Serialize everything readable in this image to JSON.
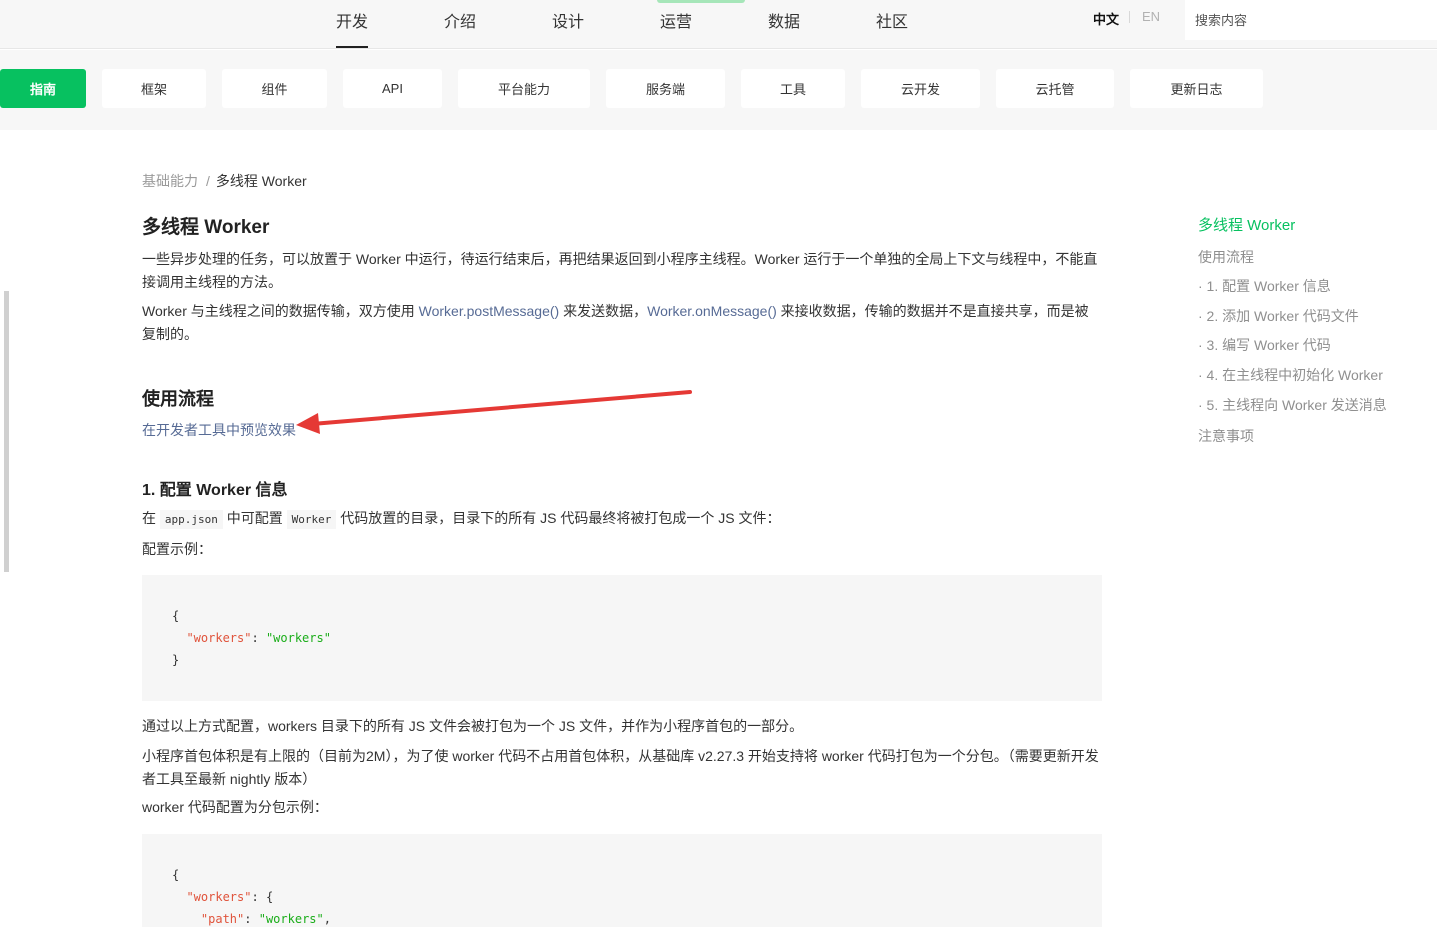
{
  "topnav": {
    "items": [
      {
        "label": "开发",
        "active": true
      },
      {
        "label": "介绍"
      },
      {
        "label": "设计"
      },
      {
        "label": "运营"
      },
      {
        "label": "数据"
      },
      {
        "label": "社区"
      }
    ],
    "lang_zh": "中文",
    "lang_en": "EN",
    "search_placeholder": "搜索内容"
  },
  "subnav": {
    "tabs": [
      {
        "label": "指南",
        "active": true
      },
      {
        "label": "框架"
      },
      {
        "label": "组件"
      },
      {
        "label": "API"
      },
      {
        "label": "平台能力"
      },
      {
        "label": "服务端"
      },
      {
        "label": "工具"
      },
      {
        "label": "云开发"
      },
      {
        "label": "云托管"
      },
      {
        "label": "更新日志"
      }
    ]
  },
  "breadcrumb": {
    "parent": "基础能力",
    "separator": "/",
    "current": "多线程 Worker"
  },
  "content": {
    "title": "多线程 Worker",
    "intro1": "一些异步处理的任务，可以放置于 Worker 中运行，待运行结束后，再把结果返回到小程序主线程。Worker 运行于一个单独的全局上下文与线程中，不能直接调用主线程的方法。",
    "intro2_a": "Worker 与主线程之间的数据传输，双方使用 ",
    "intro2_link1": "Worker.postMessage()",
    "intro2_b": " 来发送数据，",
    "intro2_link2": "Worker.onMessage()",
    "intro2_c": " 来接收数据，传输的数据并不是直接共享，而是被复制的。",
    "usage_title": "使用流程",
    "preview_link": "在开发者工具中预览效果",
    "step1_title": "1. 配置 Worker 信息",
    "step1_a": "在 ",
    "step1_code1": "app.json",
    "step1_b": " 中可配置 ",
    "step1_code2": "Worker",
    "step1_c": " 代码放置的目录，目录下的所有 JS 代码最终将被打包成一个 JS 文件：",
    "example_label": "配置示例：",
    "code1": {
      "open": "{",
      "key": "\"workers\"",
      "colon": ": ",
      "value": "\"workers\"",
      "close": "}"
    },
    "after_code1": "通过以上方式配置，workers 目录下的所有 JS 文件会被打包为一个 JS 文件，并作为小程序首包的一部分。",
    "size_note": "小程序首包体积是有上限的（目前为2M），为了使 worker 代码不占用首包体积，从基础库 v2.27.3 开始支持将 worker 代码打包为一个分包。（需要更新开发者工具至最新 nightly 版本）",
    "subpkg_label": "worker 代码配置为分包示例：",
    "code2": {
      "open": "{",
      "key1": "\"workers\"",
      "colon": ": ",
      "brace": "{",
      "key2": "\"path\"",
      "value2": "\"workers\"",
      "comma": ","
    }
  },
  "toc": {
    "items": [
      {
        "label": "多线程 Worker",
        "active": true
      },
      {
        "label": "使用流程"
      },
      {
        "label": "· 1. 配置 Worker 信息"
      },
      {
        "label": "· 2. 添加 Worker 代码文件"
      },
      {
        "label": "· 3. 编写 Worker 代码"
      },
      {
        "label": "· 4. 在主线程中初始化 Worker"
      },
      {
        "label": "· 5. 主线程向 Worker 发送消息"
      },
      {
        "label": "注意事项"
      }
    ]
  },
  "colors": {
    "accent": "#07c160",
    "link": "#576b95",
    "annotation_arrow": "#e53935"
  }
}
